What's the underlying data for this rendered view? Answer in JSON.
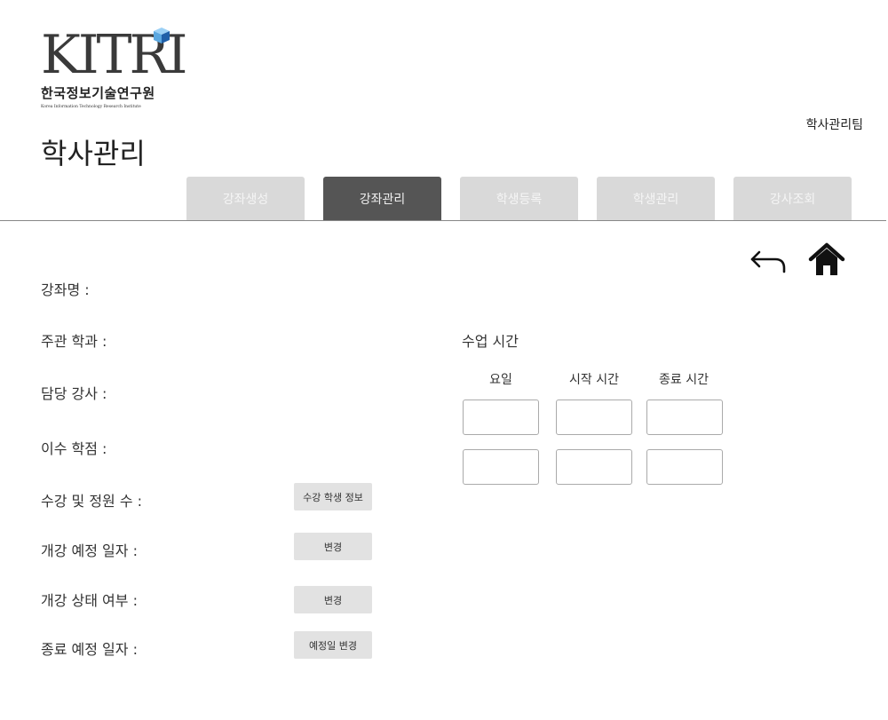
{
  "logo": {
    "word": "KITRI",
    "korean": "한국정보기술연구원",
    "english": "Korea Information Technology Research Institute",
    "cube_colors": [
      "#1f5fa8",
      "#5aa7e0",
      "#9bd0f5"
    ]
  },
  "header": {
    "team": "학사관리팀",
    "page_title": "학사관리"
  },
  "tabs": [
    {
      "label": "강좌생성",
      "active": false
    },
    {
      "label": "강좌관리",
      "active": true
    },
    {
      "label": "학생등록",
      "active": false
    },
    {
      "label": "학생관리",
      "active": false
    },
    {
      "label": "강사조회",
      "active": false
    }
  ],
  "icons": {
    "back": "back-arrow-icon",
    "home": "home-icon"
  },
  "fields": {
    "course_name": "강좌명 :",
    "department": "주관 학과 :",
    "instructor": "담당 강사 :",
    "credits": "이수 학점 :",
    "enrollment": "수강 및 정원 수 :",
    "open_date": "개강 예정 일자 :",
    "open_status": "개강 상태 여부 :",
    "end_date": "종료 예정 일자 :"
  },
  "buttons": {
    "student_info": "수강 학생 정보",
    "change_open_date": "변경",
    "change_status": "변경",
    "change_end_date": "예정일 변경"
  },
  "schedule": {
    "title": "수업 시간",
    "columns": [
      "요일",
      "시작 시간",
      "종료 시간"
    ],
    "rows": [
      [
        "",
        "",
        ""
      ],
      [
        "",
        "",
        ""
      ]
    ]
  },
  "colors": {
    "tab_inactive": "#d9d9d9",
    "tab_active": "#555555",
    "button_bg": "#e2e2e2"
  }
}
